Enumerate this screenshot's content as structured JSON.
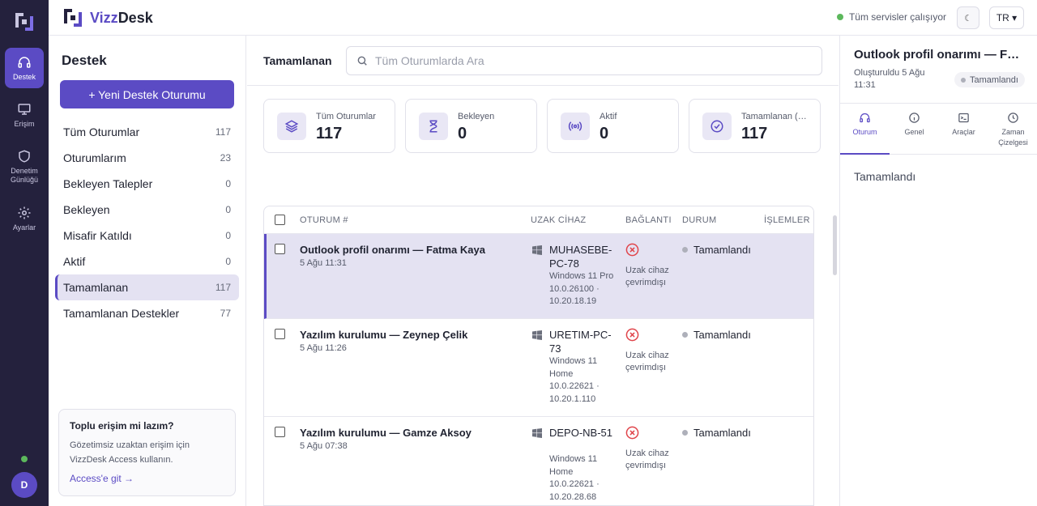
{
  "rail": {
    "items": [
      {
        "label": "Destek",
        "icon": "headset-icon",
        "active": true
      },
      {
        "label": "Erişim",
        "icon": "monitor-icon"
      },
      {
        "label": "Denetim Günlüğü",
        "icon": "shield-icon"
      },
      {
        "label": "Ayarlar",
        "icon": "gear-icon"
      }
    ],
    "avatar": "D"
  },
  "topbar": {
    "brand_part1": "Vizz",
    "brand_part2": "Desk",
    "service_status": "Tüm servisler çalışıyor",
    "theme_icon": "☾",
    "language": "TR ▾"
  },
  "left": {
    "title": "Destek",
    "new_button": "+ Yeni Destek Oturumu",
    "nav": [
      {
        "label": "Tüm Oturumlar",
        "count": "117"
      },
      {
        "label": "Oturumlarım",
        "count": "23"
      },
      {
        "label": "Bekleyen Talepler",
        "count": "0"
      },
      {
        "label": "Bekleyen",
        "count": "0"
      },
      {
        "label": "Misafir Katıldı",
        "count": "0"
      },
      {
        "label": "Aktif",
        "count": "0"
      },
      {
        "label": "Tamamlanan",
        "count": "117"
      },
      {
        "label": "Tamamlanan Destekler",
        "count": "77"
      }
    ],
    "promo": {
      "title": "Toplu erişim mi lazım?",
      "text": "Gözetimsiz uzaktan erişim için VizzDesk Access kullanın.",
      "link": "Access'e git →"
    }
  },
  "center": {
    "title": "Tamamlanan",
    "search_placeholder": "Tüm Oturumlarda Ara",
    "stats": [
      {
        "label": "Tüm Oturumlar",
        "value": "117",
        "icon": "layers-icon"
      },
      {
        "label": "Bekleyen",
        "value": "0",
        "icon": "hourglass-icon"
      },
      {
        "label": "Aktif",
        "value": "0",
        "icon": "broadcast-icon"
      },
      {
        "label": "Tamamlanan (…",
        "value": "117",
        "icon": "check-circle-icon"
      }
    ],
    "columns": {
      "session": "OTURUM #",
      "device": "UZAK CİHAZ",
      "connection": "BAĞLANTI",
      "status": "DURUM",
      "actions": "İŞLEMLER"
    },
    "rows": [
      {
        "title": "Outlook profil onarımı — Fatma Kaya",
        "time": "5 Ağu 11:31",
        "device": "MUHASEBE-PC-78",
        "os": "Windows 11 Pro 10.0.26100 · 10.20.18.19",
        "connection": "Uzak cihaz çevrimdışı",
        "status": "Tamamlandı"
      },
      {
        "title": "Yazılım kurulumu — Zeynep Çelik",
        "time": "5 Ağu 11:26",
        "device": "URETIM-PC-73",
        "os": "Windows 11 Home 10.0.22621 · 10.20.1.110",
        "connection": "Uzak cihaz çevrimdışı",
        "status": "Tamamlandı"
      },
      {
        "title": "Yazılım kurulumu — Gamze Aksoy",
        "time": "5 Ağu 07:38",
        "device": "DEPO-NB-51",
        "os": "Windows 11 Home 10.0.22621 · 10.20.28.68",
        "connection": "Uzak cihaz çevrimdışı",
        "status": "Tamamlandı"
      }
    ]
  },
  "right": {
    "title": "Outlook profil onarımı — F…",
    "created": "Oluşturuldu 5 Ağu 11:31",
    "badge": "Tamamlandı",
    "tabs": [
      {
        "label": "Oturum",
        "icon": "headset-icon",
        "active": true
      },
      {
        "label": "Genel",
        "icon": "info-icon"
      },
      {
        "label": "Araçlar",
        "icon": "terminal-icon"
      },
      {
        "label": "Zaman Çizelgesi",
        "icon": "clock-icon"
      }
    ],
    "body": "Tamamlandı"
  },
  "colors": {
    "accent": "#5b4bc4",
    "rail": "#24213d",
    "selected_row": "#e4e2f2",
    "offline": "#e0454b",
    "ok": "#5cb85c"
  }
}
